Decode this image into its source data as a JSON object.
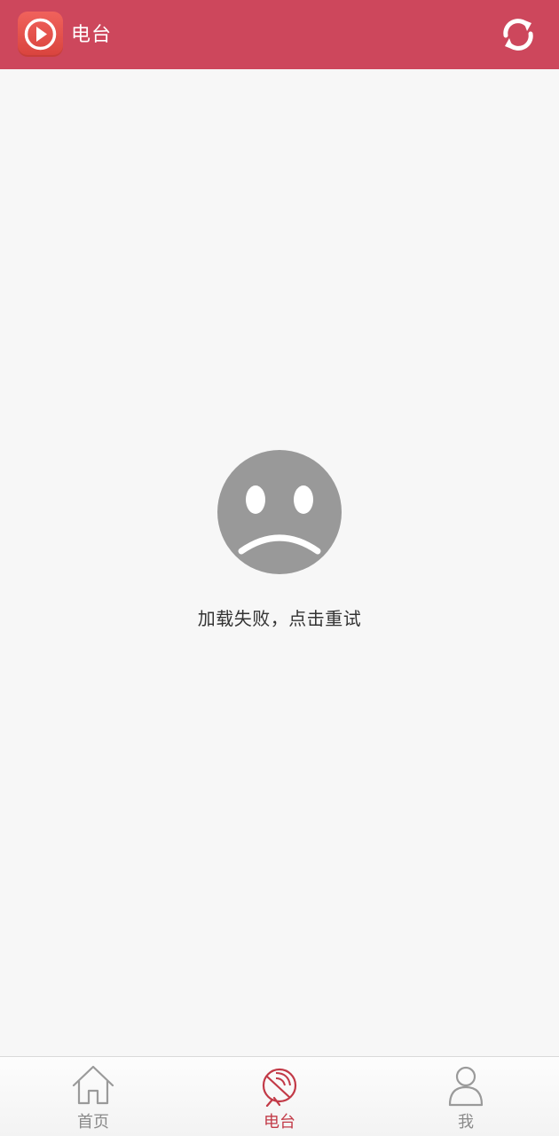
{
  "header": {
    "title": "电台",
    "logo_icon": "play-circle-icon",
    "refresh_icon": "refresh-icon",
    "background_color": "#cd475c"
  },
  "error": {
    "icon": "sad-face-icon",
    "message": "加载失败，点击重试",
    "icon_color": "#999999"
  },
  "bottom_nav": {
    "items": [
      {
        "label": "首页",
        "icon": "home-icon",
        "active": false
      },
      {
        "label": "电台",
        "icon": "radio-dish-icon",
        "active": true
      },
      {
        "label": "我",
        "icon": "user-icon",
        "active": false
      }
    ],
    "active_color": "#c23a47",
    "inactive_color": "#8a8a8a"
  }
}
